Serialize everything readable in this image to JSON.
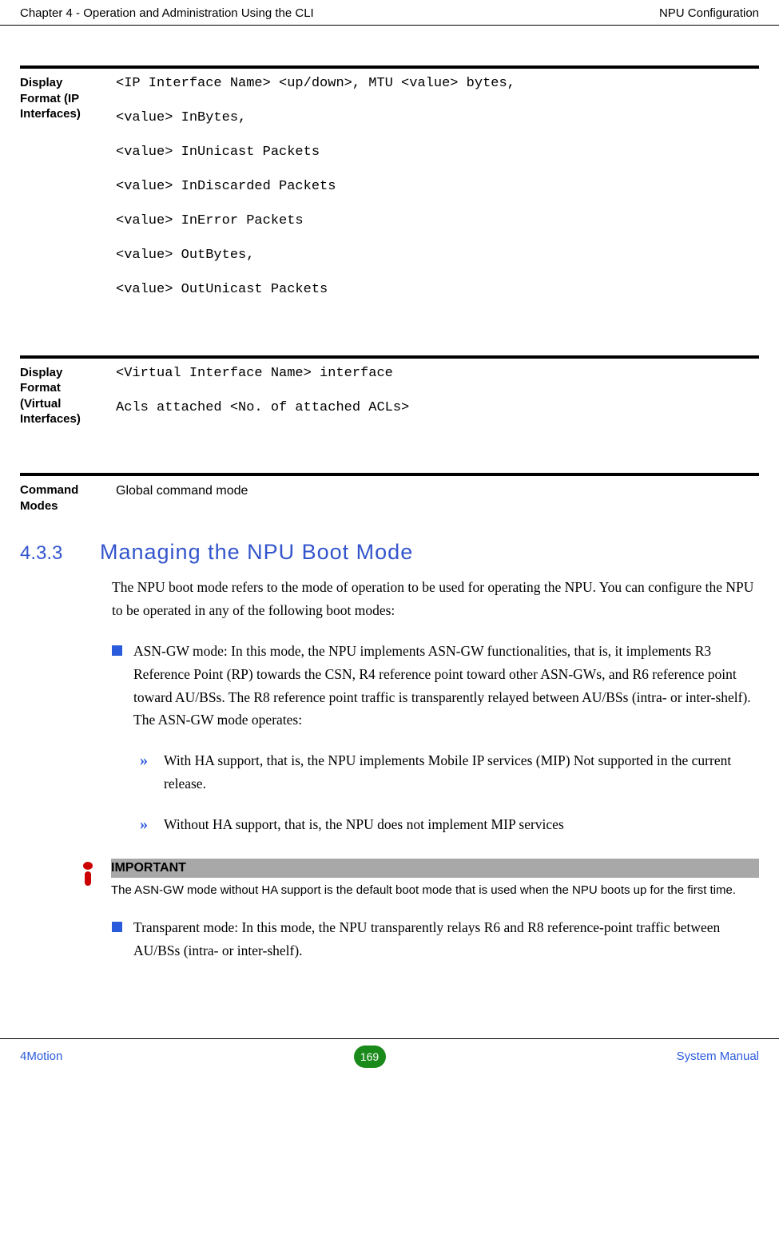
{
  "header": {
    "left": "Chapter 4 - Operation and Administration Using the CLI",
    "right": "NPU Configuration"
  },
  "defs": {
    "ip": {
      "label": "Display Format (IP Interfaces)",
      "lines": {
        "l1": "<IP Interface Name> <up/down>, MTU <value> bytes,",
        "l2": "<value> InBytes,",
        "l3": "<value> InUnicast Packets",
        "l4": "<value> InDiscarded Packets",
        "l5": "<value> InError Packets",
        "l6": "<value> OutBytes,",
        "l7": "<value> OutUnicast Packets"
      }
    },
    "virt": {
      "label": "Display Format (Virtual Interfaces)",
      "lines": {
        "l1": "<Virtual Interface Name> interface",
        "l2": "Acls attached <No. of attached ACLs>"
      }
    },
    "cmd": {
      "label": "Command Modes",
      "value": "Global command mode"
    }
  },
  "section": {
    "num": "4.3.3",
    "title": "Managing the NPU Boot Mode",
    "intro": "The NPU boot mode refers to the mode of operation to be used for operating the NPU. You can configure the NPU to be operated in any of the following boot modes:",
    "bullet1": "ASN-GW mode: In this mode, the NPU implements ASN-GW functionalities, that is, it implements R3 Reference Point (RP) towards the CSN, R4 reference point toward other ASN-GWs, and R6 reference point toward AU/BSs. The R8 reference point traffic is transparently relayed between AU/BSs (intra- or inter-shelf). The ASN-GW mode operates:",
    "sub1": "With HA support, that is, the NPU implements Mobile IP services (MIP) Not supported in the current release.",
    "sub2": "Without HA support, that is, the NPU does not implement MIP services",
    "important_label": "IMPORTANT",
    "important_text": "The ASN-GW mode without HA support is the default boot mode that is used when the NPU boots up for the first time.",
    "bullet2": "Transparent mode: In this mode, the NPU transparently relays R6 and R8 reference-point traffic between AU/BSs (intra- or inter-shelf)."
  },
  "footer": {
    "left": "4Motion",
    "page": "169",
    "right": "System Manual"
  }
}
